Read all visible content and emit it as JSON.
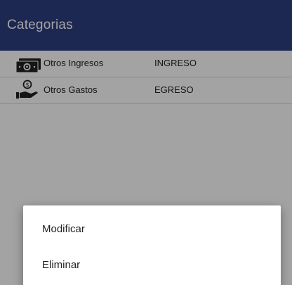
{
  "app_bar": {
    "title": "Categorias",
    "color": "#2e3f80"
  },
  "categories": [
    {
      "name": "Otros Ingresos",
      "type": "INGRESO",
      "icon": "money-bill-icon"
    },
    {
      "name": "Otros Gastos",
      "type": "EGRESO",
      "icon": "hand-coin-icon"
    }
  ],
  "dialog": {
    "items": [
      {
        "label": "Modificar"
      },
      {
        "label": "Eliminar"
      }
    ]
  }
}
